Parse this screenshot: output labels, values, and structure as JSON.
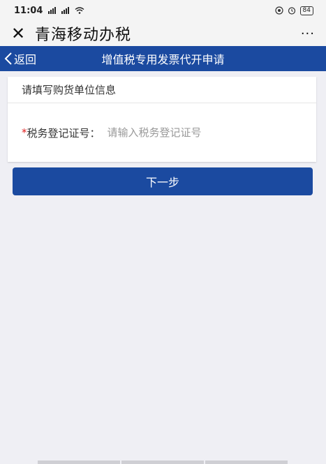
{
  "status_bar": {
    "time": "11:04",
    "battery": "84"
  },
  "titlebar": {
    "app_title": "青海移动办税",
    "more_label": "···"
  },
  "nav": {
    "back_label": "返回",
    "title": "增值税专用发票代开申请"
  },
  "form": {
    "section_title": "请填写购货单位信息",
    "required_mark": "*",
    "tax_id_label": "税务登记证号",
    "colon": "：",
    "tax_id_value": "",
    "tax_id_placeholder": "请输入税务登记证号"
  },
  "actions": {
    "next_label": "下一步"
  },
  "colors": {
    "primary": "#1b4aa0",
    "background": "#efeff4",
    "required": "#e02020"
  }
}
